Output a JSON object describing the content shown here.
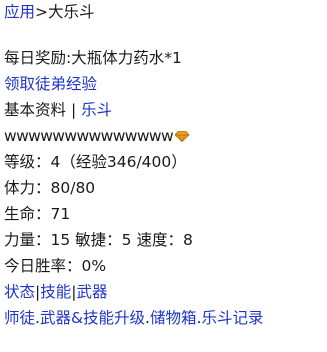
{
  "breadcrumb": {
    "app_link": "应用",
    "separator": ">",
    "current": "大乐斗"
  },
  "daily_reward": {
    "label": "每日奖励:",
    "value": "大瓶体力药水*1"
  },
  "claim_link": "领取徒弟经验",
  "profile_nav": {
    "basic_info": "基本资料",
    "separator": "|",
    "ledou_link": "乐斗"
  },
  "player": {
    "name": "wwwwwwwwwwwwww",
    "badge_icon": "gem-icon",
    "badge_color": "#f0a020"
  },
  "stats": {
    "level": "等级：4（经验346/400）",
    "stamina": "体力：80/80",
    "life": "生命：71",
    "attributes": "力量：15 敏捷：5 速度：8",
    "win_rate": "今日胜率：0%"
  },
  "tabs": {
    "status": "状态",
    "sep1": "|",
    "skills": "技能",
    "sep2": "|",
    "weapons": "武器"
  },
  "bottom_menu": {
    "mentor": "师徒",
    "dot1": ".",
    "upgrade": "武器&技能升级",
    "dot2": ".",
    "storage": "储物箱",
    "dot3": ".",
    "records": "乐斗记录"
  },
  "colors": {
    "link": "#1f35c8",
    "text": "#1a1a1a",
    "background": "#ffffff"
  }
}
